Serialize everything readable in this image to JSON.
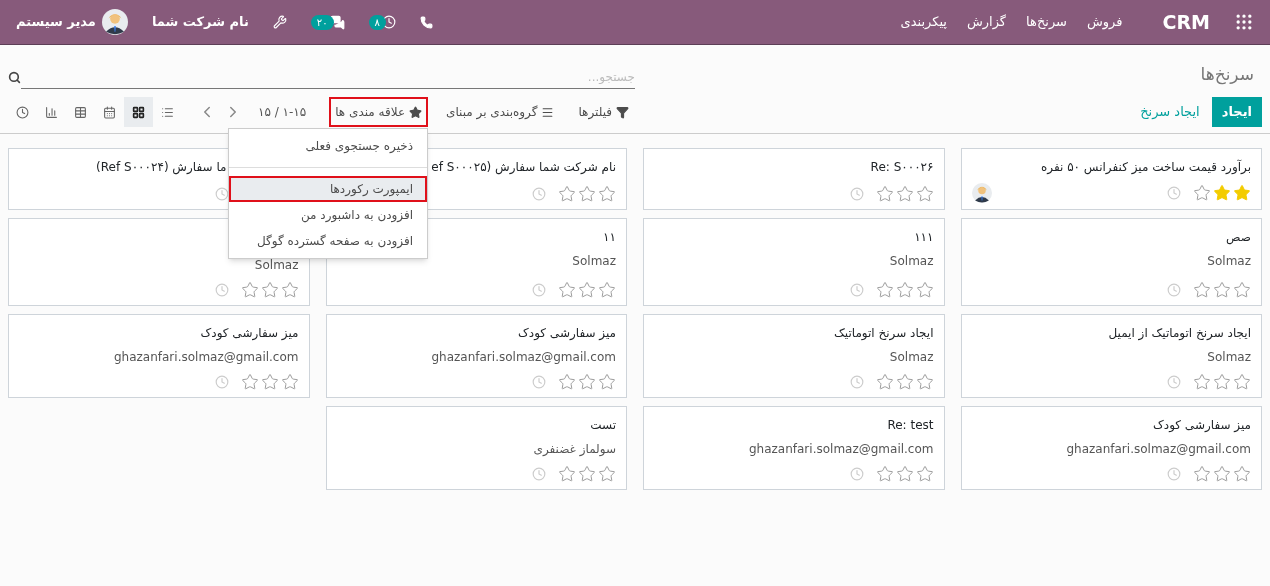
{
  "navbar": {
    "app_name": "CRM",
    "menu": [
      "فروش",
      "سرنخ‌ها",
      "گزارش",
      "پیکربندی"
    ],
    "activity_badge": "۸",
    "messages_badge": "۲۰",
    "company": "نام شرکت شما",
    "user": "مدیر سیستم"
  },
  "breadcrumb": "سرنخ‌ها",
  "search": {
    "placeholder": "جستجو..."
  },
  "buttons": {
    "create": "ایجاد",
    "generate": "ایجاد سرنخ"
  },
  "filters": [
    {
      "kind": "filter",
      "label": "فیلترها",
      "annotated": false
    },
    {
      "kind": "group",
      "label": "گروه‌بندی بر مبنای",
      "annotated": false
    },
    {
      "kind": "favorite",
      "label": "علاقه مندی ها",
      "annotated": true
    }
  ],
  "pager": "۱-۱۵ / ۱۵",
  "views": [
    {
      "kind": "list",
      "selected": false
    },
    {
      "kind": "kanban",
      "selected": true
    },
    {
      "kind": "calendar",
      "selected": false
    },
    {
      "kind": "pivot",
      "selected": false
    },
    {
      "kind": "graph",
      "selected": false
    },
    {
      "kind": "activity",
      "selected": false
    }
  ],
  "favorites_menu": [
    {
      "label": "ذخیره جستجوی فعلی",
      "hovered": false,
      "annotated": false,
      "divider_after": true
    },
    {
      "label": "ایمپورت رکوردها",
      "hovered": true,
      "annotated": true,
      "divider_after": false
    },
    {
      "label": "افزودن به داشبورد من",
      "hovered": false,
      "annotated": false,
      "divider_after": false
    },
    {
      "label": "افزودن به صفحه گسترده گوگل",
      "hovered": false,
      "annotated": false,
      "divider_after": false
    }
  ],
  "cards": [
    {
      "title": "برآورد قیمت ساخت میز کنفرانس ۵۰ نفره",
      "stars": 2,
      "avatar": true
    },
    {
      "title": "Re: S۰۰۰۲۶",
      "stars": 0,
      "avatar": false
    },
    {
      "title": "نام شرکت شما سفارش (ef S۰۰۰۲۵",
      "stars": 0,
      "avatar": false
    },
    {
      "title": "ما سفارش (Ref S۰۰۰۲۴)",
      "avatar": false
    },
    {
      "title": "صص",
      "subtitle": "Solmaz",
      "stars": 0,
      "avatar": false
    },
    {
      "title": "۱۱۱",
      "subtitle": "Solmaz",
      "stars": 0,
      "avatar": false
    },
    {
      "title": "۱۱",
      "subtitle": "Solmaz",
      "stars": 0,
      "avatar": false
    },
    {
      "subtitle": "Solmaz",
      "stars": 0,
      "avatar": false
    },
    {
      "title": "ایجاد سرنخ اتوماتیک از ایمیل",
      "subtitle": "Solmaz",
      "stars": 0,
      "avatar": false
    },
    {
      "title": "ایجاد سرنخ اتوماتیک",
      "subtitle": "Solmaz",
      "stars": 0,
      "avatar": false
    },
    {
      "title": "میز سفارشی کودک",
      "subtitle": "ghazanfari.solmaz@gmail.com",
      "stars": 0,
      "avatar": false
    },
    {
      "title": "میز سفارشی کودک",
      "subtitle": "ghazanfari.solmaz@gmail.com",
      "stars": 0,
      "avatar": false
    },
    {
      "title": "میز سفارشی کودک",
      "subtitle": "ghazanfari.solmaz@gmail.com",
      "stars": 0,
      "avatar": false
    },
    {
      "title": "Re: test",
      "subtitle": "ghazanfari.solmaz@gmail.com",
      "stars": 0,
      "avatar": false
    },
    {
      "title": "تست",
      "subtitle": "سولماز غضنفری",
      "stars": 0,
      "avatar": false
    }
  ]
}
